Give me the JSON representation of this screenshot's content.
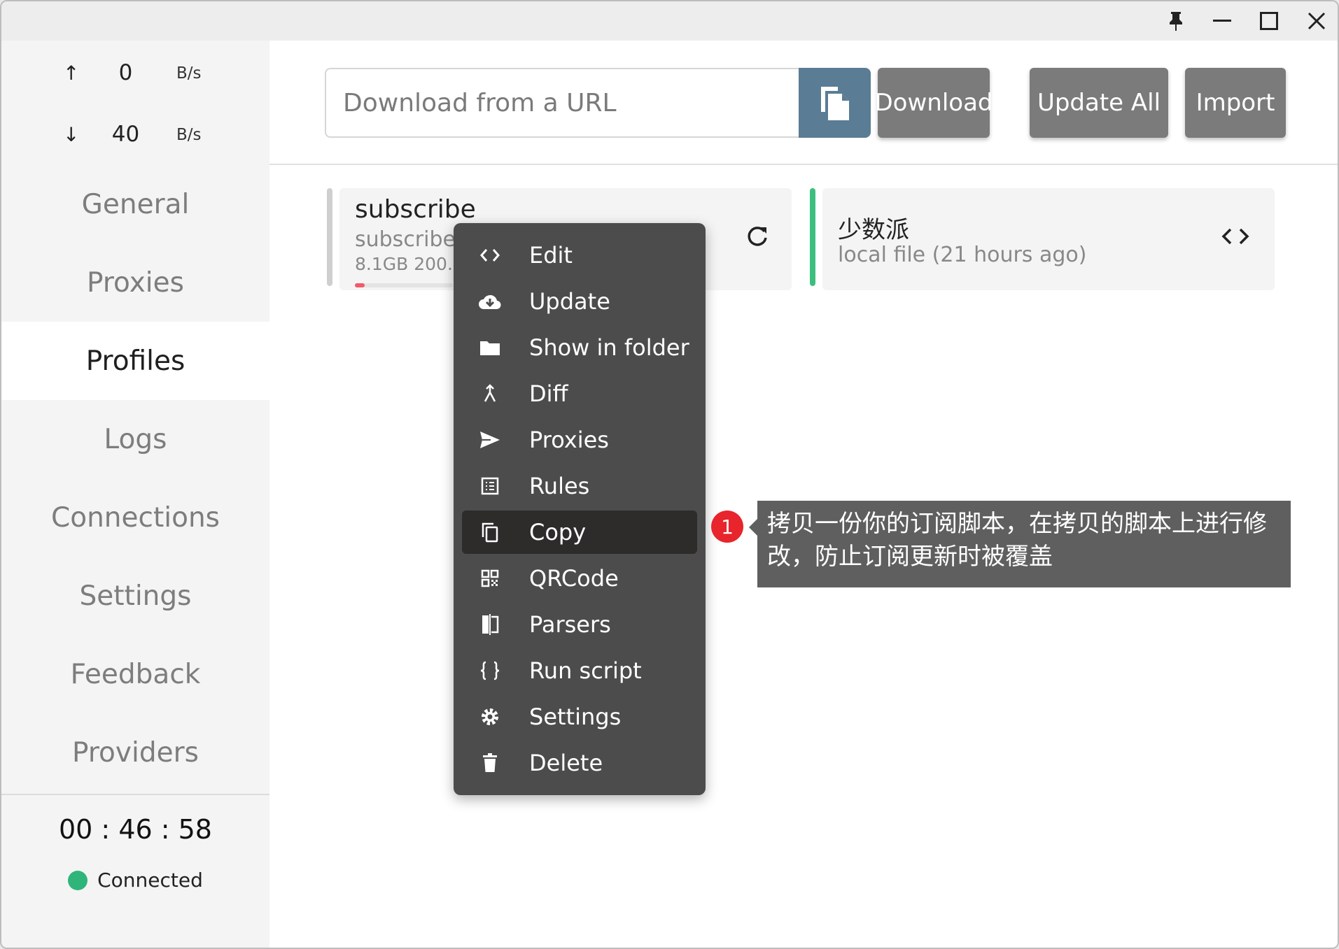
{
  "traffic": {
    "up_arrow": "↑",
    "up_value": "0",
    "up_unit": "B/s",
    "down_arrow": "↓",
    "down_value": "40",
    "down_unit": "B/s"
  },
  "nav": {
    "items": [
      "General",
      "Proxies",
      "Profiles",
      "Logs",
      "Connections",
      "Settings",
      "Feedback",
      "Providers"
    ],
    "active": "Profiles"
  },
  "clock": "00 : 46 : 58",
  "status": {
    "label": "Connected",
    "color": "#2fb57a"
  },
  "toolbar": {
    "url_placeholder": "Download from a URL",
    "download_label": "Download",
    "update_all_label": "Update All",
    "import_label": "Import"
  },
  "profiles": [
    {
      "title": "subscribe",
      "subtitle": "subscribe.",
      "meta": "8.1GB   200.",
      "accent": "#cfcfcf",
      "usage_fraction": 0.1
    },
    {
      "title": "少数派",
      "subtitle": "local file (21 hours ago)",
      "accent": "#3cbf7e"
    }
  ],
  "context_menu": {
    "items": [
      {
        "label": "Edit",
        "icon": "code-icon"
      },
      {
        "label": "Update",
        "icon": "cloud-download-icon"
      },
      {
        "label": "Show in folder",
        "icon": "folder-icon"
      },
      {
        "label": "Diff",
        "icon": "merge-icon"
      },
      {
        "label": "Proxies",
        "icon": "send-icon"
      },
      {
        "label": "Rules",
        "icon": "list-icon"
      },
      {
        "label": "Copy",
        "icon": "copy-icon"
      },
      {
        "label": "QRCode",
        "icon": "qrcode-icon"
      },
      {
        "label": "Parsers",
        "icon": "parser-icon"
      },
      {
        "label": "Run script",
        "icon": "braces-icon"
      },
      {
        "label": "Settings",
        "icon": "gear-icon"
      },
      {
        "label": "Delete",
        "icon": "trash-icon"
      }
    ],
    "highlighted": "Copy"
  },
  "callout": {
    "badge": "1",
    "text": "拷贝一份你的订阅脚本，在拷贝的脚本上进行修改，防止订阅更新时被覆盖"
  }
}
